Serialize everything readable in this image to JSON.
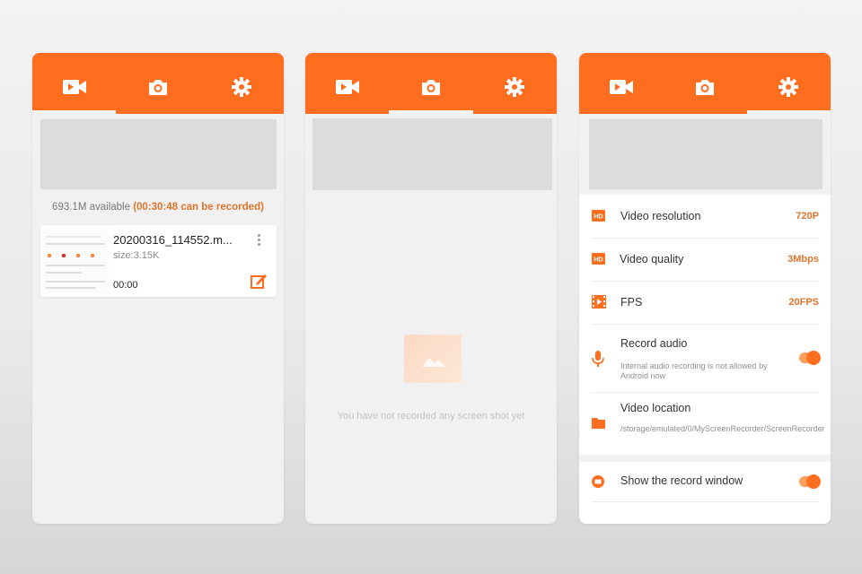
{
  "screens": {
    "recordings": {
      "available": "693.1M available",
      "can_record": "(00:30:48 can be recorded)",
      "item": {
        "name": "20200316_114552.m...",
        "size": "size:3.15K",
        "duration": "00:00"
      }
    },
    "screenshots": {
      "empty_text": "You have not recorded any screen shot yet"
    },
    "settings": {
      "rows": [
        {
          "label": "Video resolution",
          "value": "720P"
        },
        {
          "label": "Video quality",
          "value": "3Mbps"
        },
        {
          "label": "FPS",
          "value": "20FPS"
        },
        {
          "label": "Record audio",
          "sub": "Internal audio recording is not allowed by Android now"
        },
        {
          "label": "Video location",
          "sub": "/storage/emulated/0/MyScreenRecorder/ScreenRecorder"
        }
      ],
      "show_window": "Show the record window"
    }
  },
  "icons": {
    "tab1": "video-camera-icon",
    "tab2": "camera-icon",
    "tab3": "gear-icon",
    "hd": "hd-icon",
    "fps": "film-icon",
    "mic": "microphone-icon",
    "folder": "folder-icon",
    "window": "record-window-icon",
    "edit": "edit-icon"
  },
  "colors": {
    "accent": "#ff6d1f",
    "value": "#e0752b",
    "background": "#f1f1f1"
  }
}
